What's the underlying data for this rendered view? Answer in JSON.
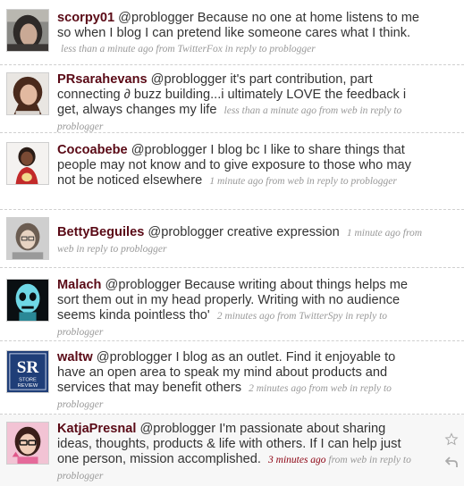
{
  "tweets": [
    {
      "user": "scorpy01",
      "text": "@problogger Because no one at home listens to me so when I blog I can pretend like someone cares what I think.",
      "meta": "less than a minute ago from TwitterFox in reply to problogger"
    },
    {
      "user": "PRsarahevans",
      "text": "@problogger it's part contribution, part connecting ∂ buzz building...i ultimately LOVE the feedback i get, always changes my life",
      "meta": "less than a minute ago from web in reply to problogger"
    },
    {
      "user": "Cocoabebe",
      "text": "@problogger I blog bc I like to share things that people may not know and to give exposure to those who may not be noticed elsewhere",
      "meta": "1 minute ago from web in reply to problogger"
    },
    {
      "user": "BettyBeguiles",
      "text": "@problogger creative expression",
      "meta": "1 minute ago from web in reply to problogger"
    },
    {
      "user": "Malach",
      "text": "@problogger Because writing about things helps me sort them out in my head properly. Writing with no audience seems kinda pointless tho'",
      "meta": "2 minutes ago from TwitterSpy in reply to problogger"
    },
    {
      "user": "waltw",
      "text": "@problogger I blog as an outlet. Find it enjoyable to have an open area to speak my mind about products and services that may benefit others",
      "meta": "2 minutes ago from web in reply to problogger"
    },
    {
      "user": "KatjaPresnal",
      "text": "@problogger I'm passionate about sharing ideas, thoughts, products & life with others. If I can help just one person, mission accomplished.",
      "meta_time": "3 minutes ago",
      "meta_rest": "from web in reply to problogger"
    }
  ],
  "avatar_logo": {
    "line1": "SR",
    "line2": "STORE",
    "line3": "REVIEW"
  },
  "colors": {
    "username": "#5a0a16",
    "text": "#333333",
    "meta": "#999999",
    "meta_hot": "#8b0010",
    "highlight": "#f7f7f7"
  },
  "icons": [
    "favorite-star-icon",
    "reply-arrow-icon"
  ]
}
